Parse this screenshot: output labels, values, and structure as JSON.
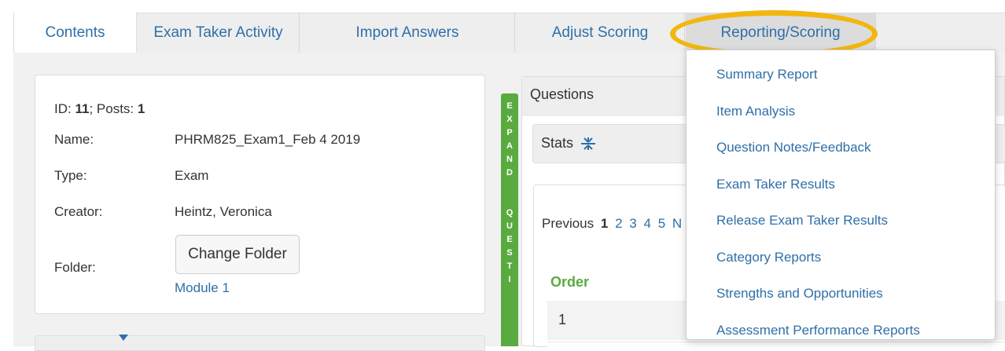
{
  "tabs": [
    {
      "label": "Contents",
      "active": true
    },
    {
      "label": "Exam Taker Activity"
    },
    {
      "label": "Import Answers"
    },
    {
      "label": "Adjust Scoring"
    },
    {
      "label": "Reporting/Scoring",
      "open": true
    }
  ],
  "colors": {
    "link": "#2f6fa8",
    "accent_green": "#5aab3f",
    "highlight": "#f2b60e"
  },
  "exam_info": {
    "id_label": "ID:",
    "id_value": "11",
    "posts_label": "Posts:",
    "posts_value": "1",
    "name_label": "Name:",
    "name_value": "PHRM825_Exam1_Feb 4 2019",
    "type_label": "Type:",
    "type_value": "Exam",
    "creator_label": "Creator:",
    "creator_value": "Heintz, Veronica",
    "folder_label": "Folder:",
    "change_folder_label": "Change Folder",
    "folder_value": "Module 1"
  },
  "expand_strip": {
    "text": "EXPAND QUESTI"
  },
  "questions": {
    "title": "Questions",
    "stats_label": "Stats",
    "stats_icon": "collapse-icon",
    "pager": {
      "previous": "Previous",
      "current": "1",
      "pages": [
        "2",
        "3",
        "4",
        "5"
      ],
      "next_partial": "N"
    },
    "order_label": "Order",
    "first_row": "1"
  },
  "reporting_menu": [
    "Summary Report",
    "Item Analysis",
    "Question Notes/Feedback",
    "Exam Taker Results",
    "Release Exam Taker Results",
    "Category Reports",
    "Strengths and Opportunities",
    "Assessment Performance Reports"
  ]
}
